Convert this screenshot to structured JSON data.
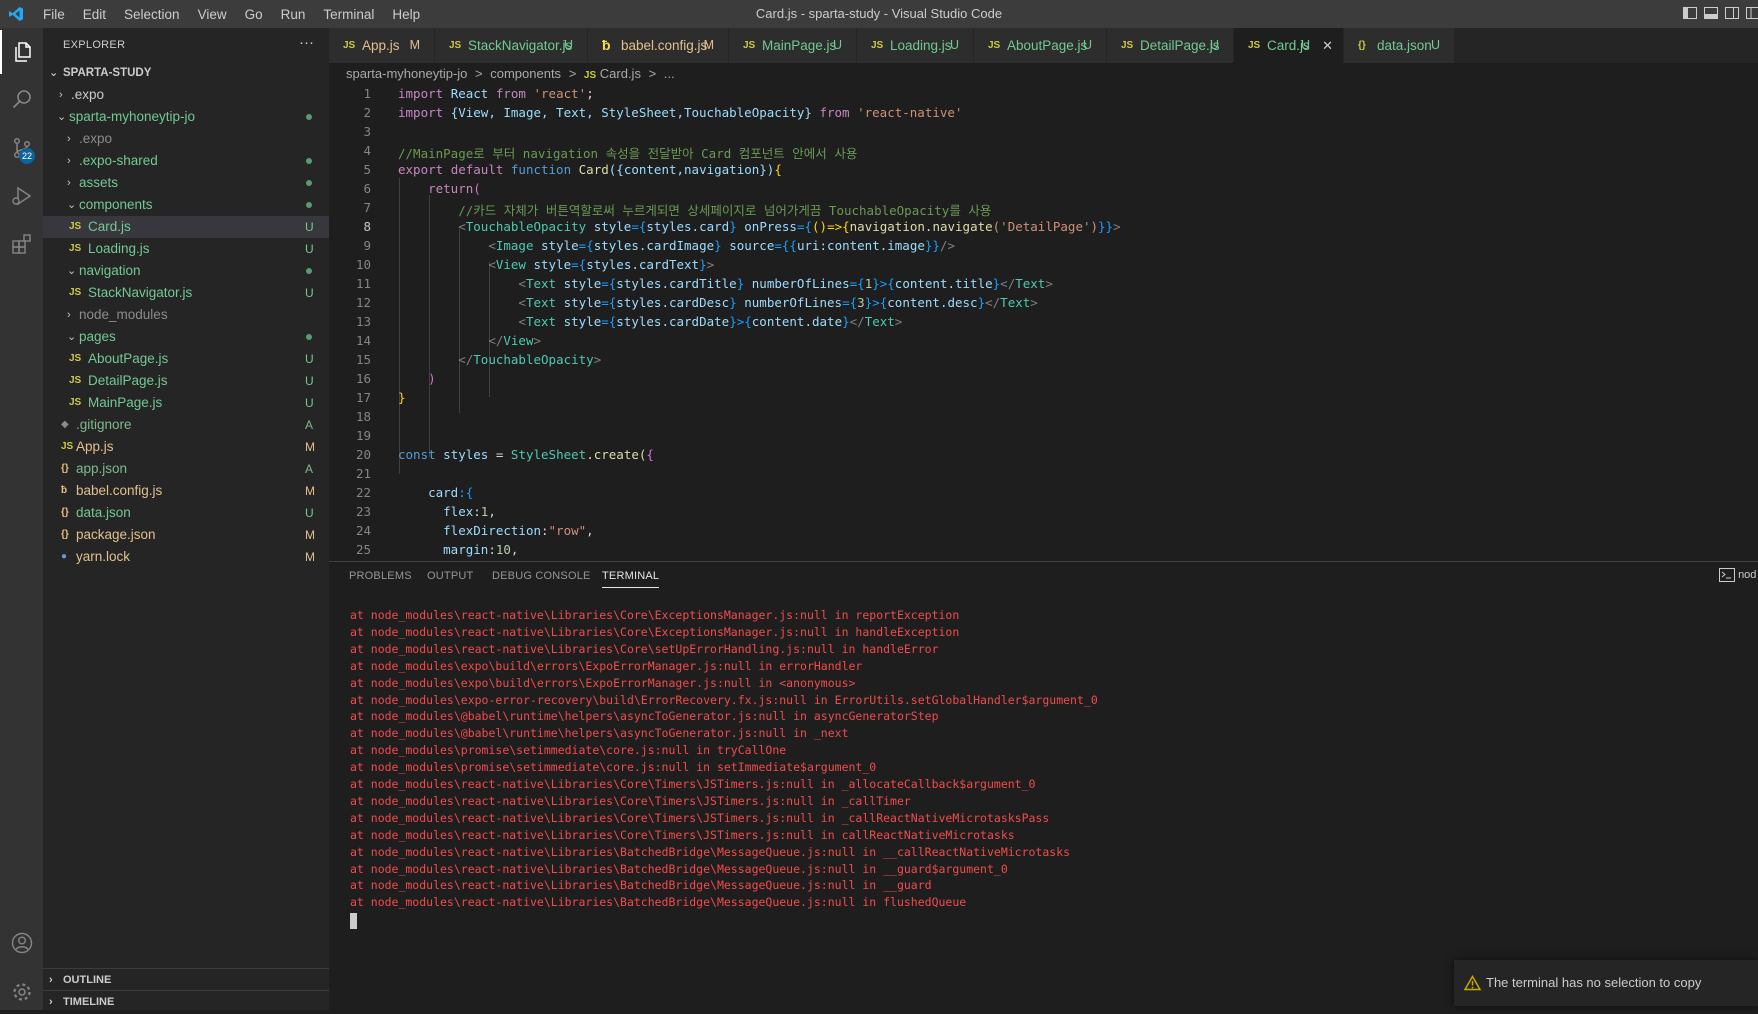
{
  "window": {
    "title": "Card.js - sparta-study - Visual Studio Code"
  },
  "menu": [
    "File",
    "Edit",
    "Selection",
    "View",
    "Go",
    "Run",
    "Terminal",
    "Help"
  ],
  "activity": {
    "scm_badge": "22"
  },
  "explorer": {
    "title": "EXPLORER",
    "more": "···",
    "root": "SPARTA-STUDY",
    "rows": [
      {
        "label": ".expo"
      },
      {
        "label": "sparta-myhoneytip-jo"
      },
      {
        "label": ".expo"
      },
      {
        "label": ".expo-shared"
      },
      {
        "label": "assets"
      },
      {
        "label": "components"
      },
      {
        "label": "Card.js",
        "status": "U"
      },
      {
        "label": "Loading.js",
        "status": "U"
      },
      {
        "label": "navigation"
      },
      {
        "label": "StackNavigator.js",
        "status": "U"
      },
      {
        "label": "node_modules"
      },
      {
        "label": "pages"
      },
      {
        "label": "AboutPage.js",
        "status": "U"
      },
      {
        "label": "DetailPage.js",
        "status": "U"
      },
      {
        "label": "MainPage.js",
        "status": "U"
      },
      {
        "label": ".gitignore",
        "status": "A"
      },
      {
        "label": "App.js",
        "status": "M"
      },
      {
        "label": "app.json",
        "status": "A"
      },
      {
        "label": "babel.config.js",
        "status": "M"
      },
      {
        "label": "data.json",
        "status": "U"
      },
      {
        "label": "package.json",
        "status": "M"
      },
      {
        "label": "yarn.lock",
        "status": "M"
      }
    ],
    "outline": "OUTLINE",
    "timeline": "TIMELINE"
  },
  "tabs": [
    {
      "icon": "JS",
      "label": "App.js",
      "status": "M"
    },
    {
      "icon": "JS",
      "label": "StackNavigator.js",
      "status": "U"
    },
    {
      "icon": "babel",
      "label": "babel.config.js",
      "status": "M"
    },
    {
      "icon": "JS",
      "label": "MainPage.js",
      "status": "U"
    },
    {
      "icon": "JS",
      "label": "Loading.js",
      "status": "U"
    },
    {
      "icon": "JS",
      "label": "AboutPage.js",
      "status": "U"
    },
    {
      "icon": "JS",
      "label": "DetailPage.js",
      "status": "U"
    },
    {
      "icon": "JS",
      "label": "Card.js",
      "status": "U",
      "close": "✕"
    },
    {
      "icon": "{}",
      "label": "data.json",
      "status": "U"
    }
  ],
  "breadcrumb": {
    "folder": "sparta-myhoneytip-jo",
    "sep": ">",
    "sub": "components",
    "file": "Card.js",
    "more": "..."
  },
  "editor": {
    "line_numbers": [
      "1",
      "2",
      "3",
      "4",
      "5",
      "6",
      "7",
      "8",
      "9",
      "10",
      "11",
      "12",
      "13",
      "14",
      "15",
      "16",
      "17",
      "18",
      "19",
      "20",
      "21",
      "22",
      "23",
      "24",
      "25"
    ],
    "code": {
      "l1": [
        "import",
        "React",
        "from",
        "'react'",
        ";"
      ],
      "l2": [
        "import",
        "{View, Image, Text, StyleSheet,TouchableOpacity}",
        "from",
        "'react-native'"
      ],
      "l4": "//MainPage로 부터 navigation 속성을 전달받아 Card 컴포넌트 안에서 사용",
      "l5": [
        "export",
        "default",
        "function",
        "Card",
        "({content,navigation})",
        "{"
      ],
      "l6": [
        "return",
        "("
      ],
      "l7": "//카드 자체가 버튼역할로써 누르게되면 상세페이지로 넘어가게끔 TouchableOpacity를 사용",
      "l8": [
        "<",
        "TouchableOpacity",
        "style",
        "={",
        "styles.card",
        "}",
        "onPress",
        "={",
        "()=>{",
        "navigation.navigate",
        "('DetailPage')",
        "}}",
        ">"
      ],
      "l9": [
        "<",
        "Image",
        "style",
        "={",
        "styles.cardImage",
        "}",
        "source",
        "={{",
        "uri:content.image",
        "}}",
        "/>"
      ],
      "l10": [
        "<",
        "View",
        "style",
        "={",
        "styles.cardText",
        "}",
        ">"
      ],
      "l11": [
        "<",
        "Text",
        "style",
        "={",
        "styles.cardTitle",
        "}",
        "numberOfLines",
        "={",
        "1",
        "}>{",
        "content.title",
        "}",
        "</",
        "Text",
        ">"
      ],
      "l12": [
        "<",
        "Text",
        "style",
        "={",
        "styles.cardDesc",
        "}",
        "numberOfLines",
        "={",
        "3",
        "}>{",
        "content.desc",
        "}",
        "</",
        "Text",
        ">"
      ],
      "l13": [
        "<",
        "Text",
        "style",
        "={",
        "styles.cardDate",
        "}",
        ">{",
        "content.date",
        "}",
        "</",
        "Text",
        ">"
      ],
      "l14": [
        "</",
        "View",
        ">"
      ],
      "l15": [
        "</",
        "TouchableOpacity",
        ">"
      ],
      "l16": ")",
      "l17": "}",
      "l20": [
        "const",
        "styles",
        "=",
        "StyleSheet",
        ".create(",
        "{"
      ],
      "l22": [
        "card",
        ":{"
      ],
      "l23": [
        "flex",
        ":",
        "1",
        ","
      ],
      "l24": [
        "flexDirection",
        ":",
        "\"row\"",
        ","
      ],
      "l25": [
        "margin",
        ":",
        "10",
        ","
      ]
    }
  },
  "panel": {
    "tabs": [
      "PROBLEMS",
      "OUTPUT",
      "DEBUG CONSOLE",
      "TERMINAL"
    ],
    "active_tab": "TERMINAL",
    "terminal_label": "nod",
    "lines": [
      "at node_modules\\react-native\\Libraries\\Core\\ExceptionsManager.js:null in reportException",
      "at node_modules\\react-native\\Libraries\\Core\\ExceptionsManager.js:null in handleException",
      "at node_modules\\react-native\\Libraries\\Core\\setUpErrorHandling.js:null in handleError",
      "at node_modules\\expo\\build\\errors\\ExpoErrorManager.js:null in errorHandler",
      "at node_modules\\expo\\build\\errors\\ExpoErrorManager.js:null in <anonymous>",
      "at node_modules\\expo-error-recovery\\build\\ErrorRecovery.fx.js:null in ErrorUtils.setGlobalHandler$argument_0",
      "at node_modules\\@babel\\runtime\\helpers\\asyncToGenerator.js:null in asyncGeneratorStep",
      "at node_modules\\@babel\\runtime\\helpers\\asyncToGenerator.js:null in _next",
      "at node_modules\\promise\\setimmediate\\core.js:null in tryCallOne",
      "at node_modules\\promise\\setimmediate\\core.js:null in setImmediate$argument_0",
      "at node_modules\\react-native\\Libraries\\Core\\Timers\\JSTimers.js:null in _allocateCallback$argument_0",
      "at node_modules\\react-native\\Libraries\\Core\\Timers\\JSTimers.js:null in _callTimer",
      "at node_modules\\react-native\\Libraries\\Core\\Timers\\JSTimers.js:null in _callReactNativeMicrotasksPass",
      "at node_modules\\react-native\\Libraries\\Core\\Timers\\JSTimers.js:null in callReactNativeMicrotasks",
      "at node_modules\\react-native\\Libraries\\BatchedBridge\\MessageQueue.js:null in __callReactNativeMicrotasks",
      "at node_modules\\react-native\\Libraries\\BatchedBridge\\MessageQueue.js:null in __guard$argument_0",
      "at node_modules\\react-native\\Libraries\\BatchedBridge\\MessageQueue.js:null in __guard",
      "at node_modules\\react-native\\Libraries\\BatchedBridge\\MessageQueue.js:null in flushedQueue"
    ]
  },
  "notification": {
    "text": "The terminal has no selection to copy",
    "icon": "warning-icon"
  }
}
